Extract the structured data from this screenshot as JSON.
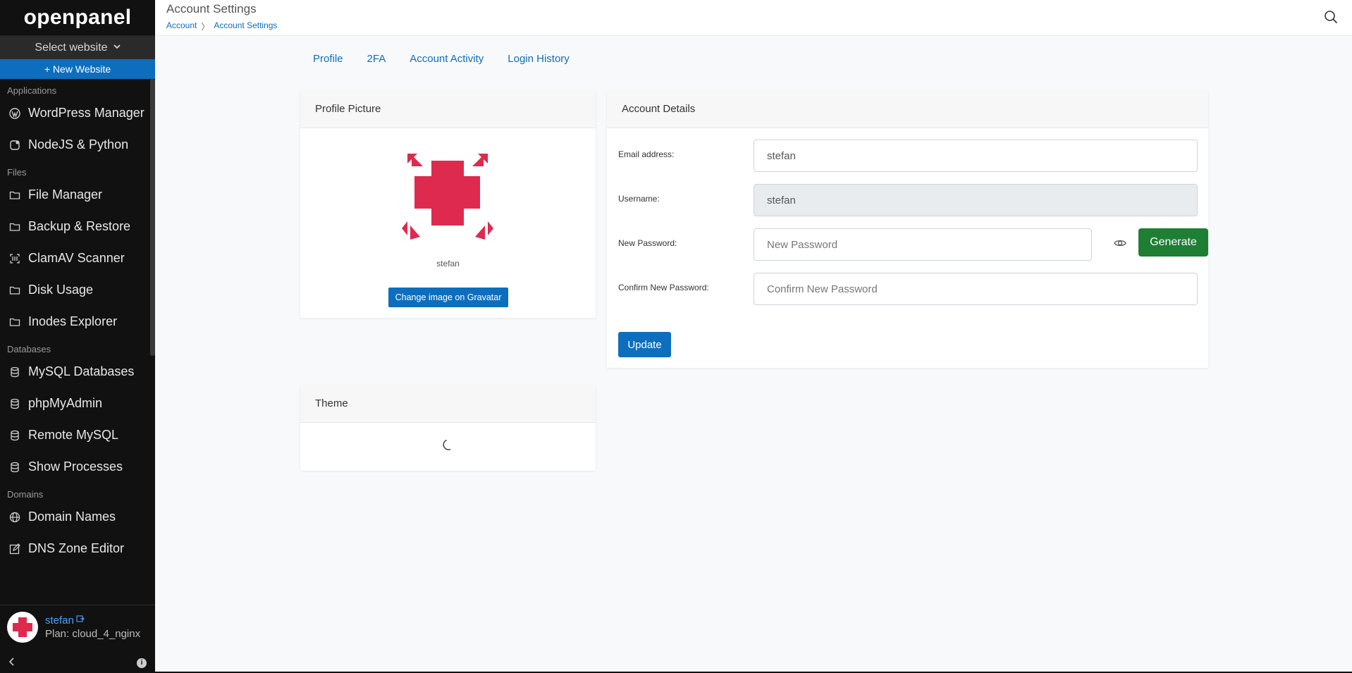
{
  "sidebar": {
    "logo": "openpanel",
    "select_website": "Select website",
    "new_website": "+ New Website",
    "sections": [
      {
        "label": "Applications",
        "items": [
          {
            "label": "WordPress Manager",
            "icon": "wordpress-icon"
          },
          {
            "label": "NodeJS & Python",
            "icon": "nodejs-icon"
          }
        ]
      },
      {
        "label": "Files",
        "items": [
          {
            "label": "File Manager",
            "icon": "folder-icon"
          },
          {
            "label": "Backup & Restore",
            "icon": "folder-icon"
          },
          {
            "label": "ClamAV Scanner",
            "icon": "scanner-icon"
          },
          {
            "label": "Disk Usage",
            "icon": "folder-icon"
          },
          {
            "label": "Inodes Explorer",
            "icon": "folder-icon"
          }
        ]
      },
      {
        "label": "Databases",
        "items": [
          {
            "label": "MySQL Databases",
            "icon": "database-icon"
          },
          {
            "label": "phpMyAdmin",
            "icon": "database-icon"
          },
          {
            "label": "Remote MySQL",
            "icon": "database-icon"
          },
          {
            "label": "Show Processes",
            "icon": "database-icon"
          }
        ]
      },
      {
        "label": "Domains",
        "items": [
          {
            "label": "Domain Names",
            "icon": "globe-icon"
          },
          {
            "label": "DNS Zone Editor",
            "icon": "edit-icon"
          }
        ]
      }
    ],
    "user": {
      "name": "stefan",
      "plan": "Plan: cloud_4_nginx"
    }
  },
  "header": {
    "title": "Account Settings",
    "breadcrumb": [
      "Account",
      "Account Settings"
    ],
    "breadcrumb_sep": "〉"
  },
  "tabs": [
    "Profile",
    "2FA",
    "Account Activity",
    "Login History"
  ],
  "profile_card": {
    "title": "Profile Picture",
    "username": "stefan",
    "button": "Change image on Gravatar"
  },
  "account_card": {
    "title": "Account Details",
    "email_label": "Email address:",
    "email_value": "stefan",
    "username_label": "Username:",
    "username_value": "stefan",
    "new_password_label": "New Password:",
    "new_password_placeholder": "New Password",
    "generate_button": "Generate",
    "confirm_label": "Confirm New Password:",
    "confirm_placeholder": "Confirm New Password",
    "update_button": "Update"
  },
  "theme_card": {
    "title": "Theme",
    "icon": "moon-icon"
  },
  "colors": {
    "primary": "#0d6ebd",
    "success": "#1e7e34",
    "sidebar": "#111111",
    "gravatar": "#de2a4e"
  }
}
